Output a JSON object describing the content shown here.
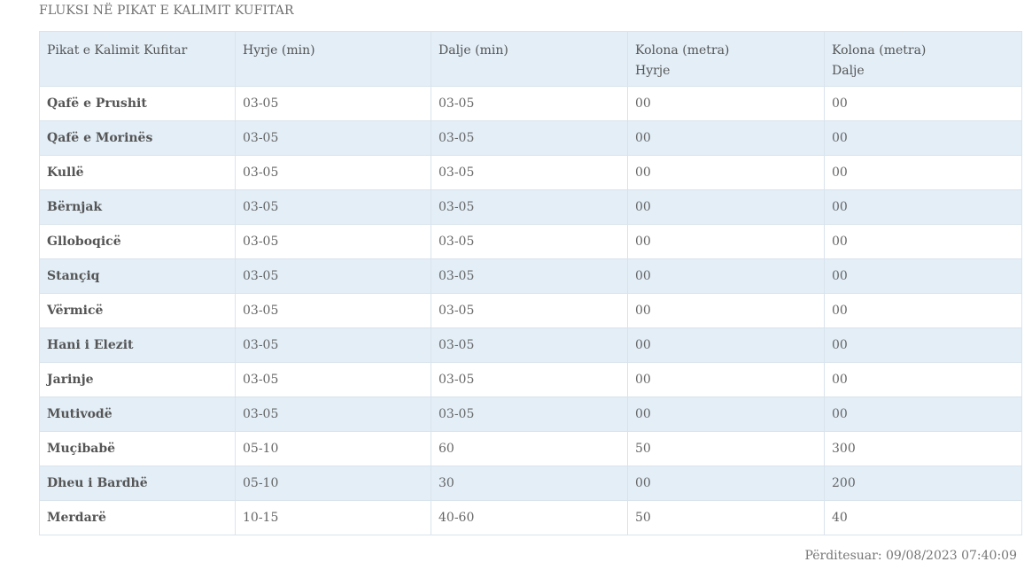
{
  "page": {
    "title": "FLUKSI NË PIKAT E KALIMIT KUFITAR",
    "updated_text": "Përditesuar: 09/08/2023 07:40:09"
  },
  "table": {
    "headers": [
      {
        "line1": "Pikat e Kalimit Kufitar",
        "line2": ""
      },
      {
        "line1": "Hyrje (min)",
        "line2": ""
      },
      {
        "line1": "Dalje (min)",
        "line2": ""
      },
      {
        "line1": "Kolona (metra)",
        "line2": "Hyrje"
      },
      {
        "line1": "Kolona (metra)",
        "line2": "Dalje"
      }
    ],
    "rows": [
      [
        "Qafë e Prushit",
        "03-05",
        "03-05",
        "00",
        "00"
      ],
      [
        "Qafë e Morinës",
        "03-05",
        "03-05",
        "00",
        "00"
      ],
      [
        "Kullë",
        "03-05",
        "03-05",
        "00",
        "00"
      ],
      [
        "Bërnjak",
        "03-05",
        "03-05",
        "00",
        "00"
      ],
      [
        "Glloboqicë",
        "03-05",
        "03-05",
        "00",
        "00"
      ],
      [
        "Stançiq",
        "03-05",
        "03-05",
        "00",
        "00"
      ],
      [
        "Vërmicë",
        "03-05",
        "03-05",
        "00",
        "00"
      ],
      [
        "Hani i Elezit",
        "03-05",
        "03-05",
        "00",
        "00"
      ],
      [
        "Jarinje",
        "03-05",
        "03-05",
        "00",
        "00"
      ],
      [
        "Mutivodë",
        "03-05",
        "03-05",
        "00",
        "00"
      ],
      [
        "Muçibabë",
        "05-10",
        "60",
        "50",
        "300"
      ],
      [
        "Dheu i Bardhë",
        "05-10",
        "30",
        "00",
        "200"
      ],
      [
        "Merdarë",
        "10-15",
        "40-60",
        "50",
        "40"
      ]
    ]
  },
  "colors": {
    "header_bg": "#e3eef7",
    "stripe_bg": "#e3eef7",
    "border": "#d9e3ec",
    "text": "#555555"
  }
}
